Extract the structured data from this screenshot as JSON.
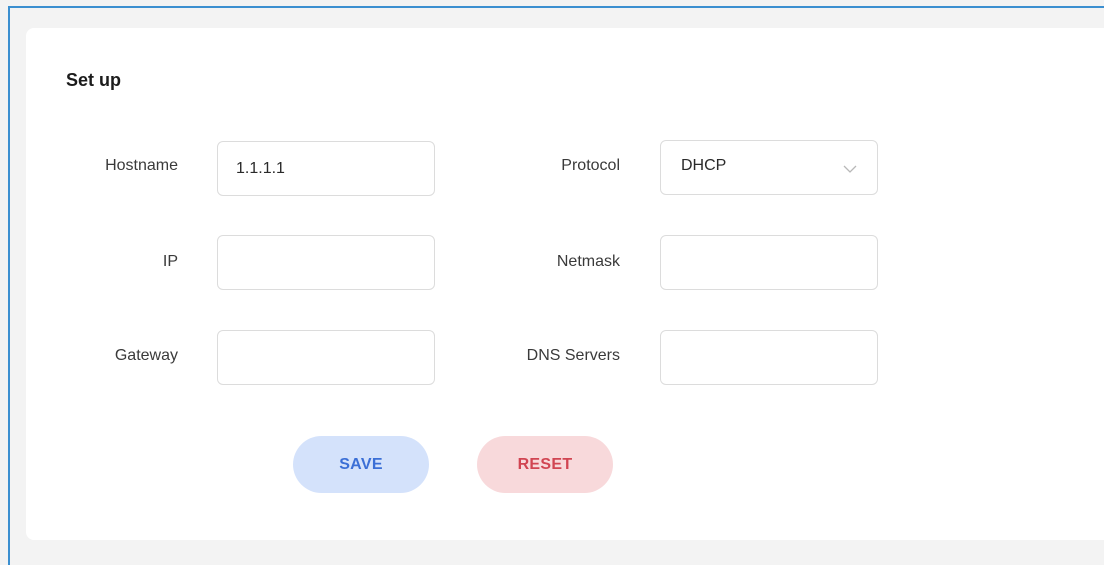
{
  "form": {
    "title": "Set up",
    "hostname": {
      "label": "Hostname",
      "value": "1.1.1.1",
      "placeholder": ""
    },
    "protocol": {
      "label": "Protocol",
      "selected": "DHCP"
    },
    "ip": {
      "label": "IP",
      "value": "",
      "placeholder": ""
    },
    "netmask": {
      "label": "Netmask",
      "value": "",
      "placeholder": ""
    },
    "gateway": {
      "label": "Gateway",
      "value": "",
      "placeholder": ""
    },
    "dns": {
      "label": "DNS Servers",
      "value": "",
      "placeholder": ""
    }
  },
  "actions": {
    "save_label": "SAVE",
    "reset_label": "RESET"
  },
  "colors": {
    "frame_border": "#3b8fd0",
    "save_bg": "#d4e2fb",
    "save_text": "#3b6fd6",
    "reset_bg": "#f8d9db",
    "reset_text": "#d14552"
  },
  "icons": {
    "protocol_dropdown": "chevron-down-icon"
  }
}
